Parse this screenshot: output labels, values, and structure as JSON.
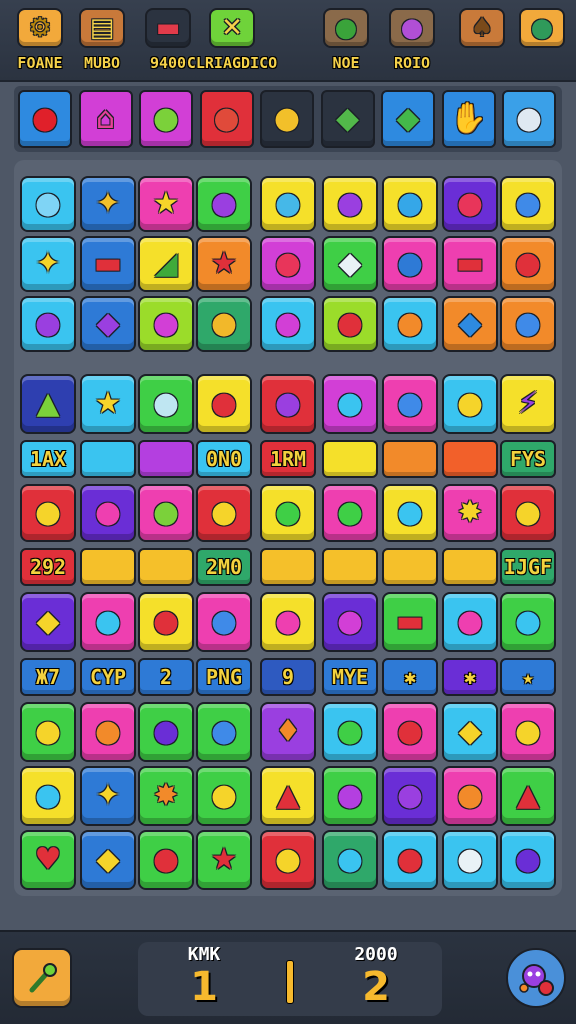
{
  "header": {
    "items": [
      {
        "label": "FOANE",
        "icon": "gear-icon",
        "bg": "#f2a93b",
        "glyph": "⚙",
        "glyph_color": "#b8860b"
      },
      {
        "label": "MUBO",
        "icon": "card-icon",
        "bg": "#c8793a",
        "glyph": "▤",
        "glyph_color": "#f5d24a"
      },
      {
        "label": "9400",
        "icon": "flag-icon",
        "bg": "#2b3340",
        "glyph": "▬",
        "glyph_color": "#e23b4a"
      },
      {
        "label": "CLRIAGDICO",
        "icon": "cross-icon",
        "bg": "#6fd33a",
        "glyph": "✕",
        "glyph_color": "#f5d24a"
      },
      {
        "label": "NOE",
        "icon": "frog-icon",
        "bg": "#8a6a4a",
        "glyph": "●",
        "glyph_color": "#3aa33a"
      },
      {
        "label": "ROIO",
        "icon": "monster-icon",
        "bg": "#8a6a4a",
        "glyph": "●",
        "glyph_color": "#b14fd6"
      },
      {
        "label": "",
        "icon": "bag-icon",
        "bg": "#c97a3a",
        "glyph": "♠",
        "glyph_color": "#7a4a1a"
      },
      {
        "label": "",
        "icon": "alien-icon",
        "bg": "#f2a93b",
        "glyph": "●",
        "glyph_color": "#2f9a5a"
      }
    ]
  },
  "tray": [
    {
      "bg": "#2e8ae0",
      "glyph": "●",
      "color": "#e0202a",
      "icon": "red-ball-icon"
    },
    {
      "bg": "#d23fd6",
      "glyph": "⌂",
      "color": "#e8409a",
      "icon": "pink-house-icon"
    },
    {
      "bg": "#d23fd6",
      "glyph": "●",
      "color": "#7bd13a",
      "icon": "green-face-icon"
    },
    {
      "bg": "#e0303a",
      "glyph": "●",
      "color": "#e04a3a",
      "icon": "fish-icon"
    },
    {
      "bg": "#2b3340",
      "glyph": "●",
      "color": "#f2c02a",
      "icon": "sun-face-icon"
    },
    {
      "bg": "#2b3340",
      "glyph": "◆",
      "color": "#52b84a",
      "icon": "leaf-icon"
    },
    {
      "bg": "#2e8ae0",
      "glyph": "◆",
      "color": "#44b84a",
      "icon": "green-leaf-icon"
    },
    {
      "bg": "#2e8ae0",
      "glyph": "✋",
      "color": "#d98a3a",
      "icon": "glove-icon"
    },
    {
      "bg": "#3aa0e8",
      "glyph": "●",
      "color": "#dfe9f2",
      "icon": "ghost-icon"
    }
  ],
  "grid": {
    "rows": [
      [
        {
          "bg": "#3ac4f0",
          "g": "●",
          "c": "#7fd4f5",
          "i": "fish-icon"
        },
        {
          "bg": "#2e7ad6",
          "g": "✦",
          "c": "#f2c02a",
          "i": "sparkle-icon"
        },
        {
          "bg": "#ee3fb0",
          "g": "★",
          "c": "#f5d42a",
          "i": "star-icon"
        },
        {
          "bg": "#3fcf46",
          "g": "●",
          "c": "#9a3fe0",
          "i": "purple-face-icon"
        },
        {
          "bg": "#f5e02a",
          "g": "●",
          "c": "#45b8e8",
          "i": "blue-drop-icon"
        },
        {
          "bg": "#f5e02a",
          "g": "●",
          "c": "#9a3fe0",
          "i": "purple-ball-icon"
        },
        {
          "bg": "#f5e02a",
          "g": "●",
          "c": "#35a7e8",
          "i": "blue-ball-icon"
        },
        {
          "bg": "#6a2ed6",
          "g": "●",
          "c": "#e8355a",
          "i": "red-blob-icon"
        },
        {
          "bg": "#f5e02a",
          "g": "●",
          "c": "#3f8ae8",
          "i": "blue-face-icon"
        }
      ],
      [
        {
          "bg": "#3ac4f0",
          "g": "✦",
          "c": "#f5d42a",
          "i": "sparkle-icon"
        },
        {
          "bg": "#2e7ad6",
          "g": "▬",
          "c": "#e0303a",
          "i": "red-bar-icon"
        },
        {
          "bg": "#f5e02a",
          "g": "◢",
          "c": "#3faa3a",
          "i": "pencil-icon"
        },
        {
          "bg": "#f28a2a",
          "g": "★",
          "c": "#e0303a",
          "i": "red-star-icon"
        },
        {
          "bg": "#d23fd6",
          "g": "●",
          "c": "#e8355a",
          "i": "apple-icon"
        },
        {
          "bg": "#3fcf46",
          "g": "◆",
          "c": "#e9f2f6",
          "i": "diamond-icon"
        },
        {
          "bg": "#ee3fb0",
          "g": "●",
          "c": "#2e7ad6",
          "i": "blue-orb-icon"
        },
        {
          "bg": "#ee3fb0",
          "g": "▬",
          "c": "#e0303a",
          "i": "chili-icon"
        },
        {
          "bg": "#f28a2a",
          "g": "●",
          "c": "#e0303a",
          "i": "tomato-icon"
        }
      ],
      [
        {
          "bg": "#3ac4f0",
          "g": "●",
          "c": "#9a3fe0",
          "i": "purple-face-icon"
        },
        {
          "bg": "#2e7ad6",
          "g": "◆",
          "c": "#9a3fe0",
          "i": "purple-gem-icon"
        },
        {
          "bg": "#9bdc2a",
          "g": "●",
          "c": "#d23fd6",
          "i": "pink-face-icon"
        },
        {
          "bg": "#2fa86a",
          "g": "●",
          "c": "#f2b82a",
          "i": "orange-ball-icon"
        },
        {
          "bg": "#3ac4f0",
          "g": "●",
          "c": "#d23fd6",
          "i": "pink-drop-icon"
        },
        {
          "bg": "#9bdc2a",
          "g": "●",
          "c": "#e0303a",
          "i": "red-face-icon"
        },
        {
          "bg": "#3ac4f0",
          "g": "●",
          "c": "#f28a2a",
          "i": "orange-fruit-icon"
        },
        {
          "bg": "#f28a2a",
          "g": "◆",
          "c": "#2e8ae0",
          "i": "blue-gem-icon"
        },
        {
          "bg": "#f28a2a",
          "g": "●",
          "c": "#3f8ae8",
          "i": "blue-face-icon"
        }
      ],
      [
        {
          "bg": "#2e3fb0",
          "g": "▲",
          "c": "#7bd13a",
          "i": "potion-icon"
        },
        {
          "bg": "#3ac4f0",
          "g": "★",
          "c": "#f5d42a",
          "i": "star-icon"
        },
        {
          "bg": "#3fcf46",
          "g": "●",
          "c": "#bfe6f2",
          "i": "white-orb-icon"
        },
        {
          "bg": "#f5e02a",
          "g": "●",
          "c": "#e0303a",
          "i": "apple-icon"
        },
        {
          "bg": "#e0303a",
          "g": "●",
          "c": "#9a3fe0",
          "i": "purple-ball-icon"
        },
        {
          "bg": "#d23fd6",
          "g": "●",
          "c": "#3ac4f0",
          "i": "blue-face-icon"
        },
        {
          "bg": "#ee3fb0",
          "g": "●",
          "c": "#3f8ae8",
          "i": "blue-bird-icon"
        },
        {
          "bg": "#3ac4f0",
          "g": "●",
          "c": "#f5d42a",
          "i": "yellow-face-icon"
        },
        {
          "bg": "#f5e02a",
          "g": "⚡",
          "c": "#9a3fe0",
          "i": "lightning-icon"
        }
      ]
    ],
    "bar_row1": [
      {
        "text": "1AX",
        "bg": "#3ac4f0",
        "span": 1
      },
      {
        "text": "",
        "bg": "#3ac4f0",
        "span": 1
      },
      {
        "text": "",
        "bg": "#b43fe0",
        "span": 1
      },
      {
        "text": "0N0",
        "bg": "#3ac4f0",
        "span": 1
      },
      {
        "text": "1RM",
        "bg": "#e0303a",
        "span": 1
      },
      {
        "text": "",
        "bg": "#f5e02a",
        "span": 1
      },
      {
        "text": "",
        "bg": "#f28a2a",
        "span": 1
      },
      {
        "text": "",
        "bg": "#f2602a",
        "span": 1
      },
      {
        "text": "FYS",
        "bg": "#2fa86a",
        "span": 1
      }
    ],
    "mid_row": [
      {
        "bg": "#e0303a",
        "g": "●",
        "c": "#f5d42a",
        "i": "sun-face-icon"
      },
      {
        "bg": "#6a2ed6",
        "g": "●",
        "c": "#ee3fb0",
        "i": "balloon-icon"
      },
      {
        "bg": "#ee3fb0",
        "g": "●",
        "c": "#7bd13a",
        "i": "green-face-icon"
      },
      {
        "bg": "#e0303a",
        "g": "●",
        "c": "#f5d42a",
        "i": "sun-face-icon"
      },
      {
        "bg": "#f5e02a",
        "g": "●",
        "c": "#3fcf46",
        "i": "frog-icon"
      },
      {
        "bg": "#ee3fb0",
        "g": "●",
        "c": "#3fcf46",
        "i": "green-face-icon"
      },
      {
        "bg": "#f5e02a",
        "g": "●",
        "c": "#3ac4f0",
        "i": "blue-drop-icon"
      },
      {
        "bg": "#ee3fb0",
        "g": "✸",
        "c": "#f5d42a",
        "i": "burst-icon"
      },
      {
        "bg": "#e0303a",
        "g": "●",
        "c": "#f5d42a",
        "i": "sun-face-icon"
      }
    ],
    "bar_row2": [
      {
        "text": "292",
        "bg": "#e0303a",
        "span": 1
      },
      {
        "text": "",
        "bg": "#f5c02a",
        "span": 1
      },
      {
        "text": "",
        "bg": "#f5c02a",
        "span": 1
      },
      {
        "text": "2M0",
        "bg": "#2fa86a",
        "span": 1
      },
      {
        "text": "",
        "bg": "#f5c02a",
        "span": 1
      },
      {
        "text": "",
        "bg": "#f5c02a",
        "span": 1
      },
      {
        "text": "",
        "bg": "#f5c02a",
        "span": 1
      },
      {
        "text": "",
        "bg": "#f5c02a",
        "span": 1
      },
      {
        "text": "IJGF",
        "bg": "#2fa86a",
        "span": 1
      }
    ],
    "row5": [
      {
        "bg": "#6a2ed6",
        "g": "◆",
        "c": "#f5d42a",
        "i": "ticket-icon"
      },
      {
        "bg": "#ee3fb0",
        "g": "●",
        "c": "#3ac4f0",
        "i": "balloon-icon"
      },
      {
        "bg": "#f5e02a",
        "g": "●",
        "c": "#e0303a",
        "i": "tomato-icon"
      },
      {
        "bg": "#ee3fb0",
        "g": "●",
        "c": "#3f8ae8",
        "i": "blue-face-icon"
      },
      {
        "bg": "#f5e02a",
        "g": "●",
        "c": "#ee3fb0",
        "i": "spider-icon"
      },
      {
        "bg": "#6a2ed6",
        "g": "●",
        "c": "#d23fd6",
        "i": "pink-ball-icon"
      },
      {
        "bg": "#3fcf46",
        "g": "▬",
        "c": "#e0303a",
        "i": "flag-icon"
      },
      {
        "bg": "#3ac4f0",
        "g": "●",
        "c": "#ee3fb0",
        "i": "balloon-icon"
      },
      {
        "bg": "#3fcf46",
        "g": "●",
        "c": "#3ac4f0",
        "i": "blue-face-icon"
      }
    ],
    "bar_row3": [
      {
        "text": "Ж7",
        "bg": "#2e7ad6"
      },
      {
        "text": "CYP",
        "bg": "#2e7ad6"
      },
      {
        "text": "2",
        "bg": "#2e7ad6"
      },
      {
        "text": "PNG",
        "bg": "#2e7ad6"
      },
      {
        "text": "9",
        "bg": "#2e5ac0"
      },
      {
        "text": "MYE",
        "bg": "#2e7ad6"
      },
      {
        "text": "✱",
        "bg": "#2e7ad6"
      },
      {
        "text": "✱",
        "bg": "#6a2ed6"
      },
      {
        "text": "★",
        "bg": "#2e7ad6"
      }
    ],
    "rows_bottom": [
      [
        {
          "bg": "#3fcf46",
          "g": "●",
          "c": "#f5d42a",
          "i": "sun-face-icon"
        },
        {
          "bg": "#ee3fb0",
          "g": "●",
          "c": "#f28a2a",
          "i": "orange-fruit-icon"
        },
        {
          "bg": "#3fcf46",
          "g": "●",
          "c": "#6a2ed6",
          "i": "purple-ball-icon"
        },
        {
          "bg": "#3fcf46",
          "g": "●",
          "c": "#3f8ae8",
          "i": "blue-bird-icon"
        },
        {
          "bg": "#9a3fe0",
          "g": "♦",
          "c": "#f28a2a",
          "i": "orange-drop-icon"
        },
        {
          "bg": "#3ac4f0",
          "g": "●",
          "c": "#3fcf46",
          "i": "green-ball-icon"
        },
        {
          "bg": "#ee3fb0",
          "g": "●",
          "c": "#e0303a",
          "i": "red-face-icon"
        },
        {
          "bg": "#3ac4f0",
          "g": "◆",
          "c": "#f5d42a",
          "i": "corn-icon"
        },
        {
          "bg": "#ee3fb0",
          "g": "●",
          "c": "#f5d42a",
          "i": "yellow-face-icon"
        }
      ],
      [
        {
          "bg": "#f5e02a",
          "g": "●",
          "c": "#3ac4f0",
          "i": "blue-bird-icon"
        },
        {
          "bg": "#2e7ad6",
          "g": "✦",
          "c": "#f5d42a",
          "i": "sparkle-icon"
        },
        {
          "bg": "#3fcf46",
          "g": "✸",
          "c": "#f28a2a",
          "i": "burst-icon"
        },
        {
          "bg": "#3fcf46",
          "g": "●",
          "c": "#f5d42a",
          "i": "fruit-icon"
        },
        {
          "bg": "#f5e02a",
          "g": "▲",
          "c": "#e0303a",
          "i": "cake-icon"
        },
        {
          "bg": "#3fcf46",
          "g": "●",
          "c": "#b43fe0",
          "i": "purple-ball-icon"
        },
        {
          "bg": "#6a2ed6",
          "g": "●",
          "c": "#9a3fe0",
          "i": "purple-ball-icon"
        },
        {
          "bg": "#ee3fb0",
          "g": "●",
          "c": "#f28a2a",
          "i": "orange-fish-icon"
        },
        {
          "bg": "#3fcf46",
          "g": "▲",
          "c": "#e0303a",
          "i": "chili-icon"
        }
      ],
      [
        {
          "bg": "#3fcf46",
          "g": "♥",
          "c": "#e0303a",
          "i": "apple-icon"
        },
        {
          "bg": "#2e7ad6",
          "g": "◆",
          "c": "#f5d42a",
          "i": "corn-icon"
        },
        {
          "bg": "#3fcf46",
          "g": "●",
          "c": "#e0303a",
          "i": "apple-icon"
        },
        {
          "bg": "#3fcf46",
          "g": "★",
          "c": "#e0303a",
          "i": "red-star-icon"
        },
        {
          "bg": "#e0303a",
          "g": "●",
          "c": "#f5d42a",
          "i": "yellow-face-icon"
        },
        {
          "bg": "#2fa86a",
          "g": "●",
          "c": "#3ac4f0",
          "i": "blue-bird-icon"
        },
        {
          "bg": "#3ac4f0",
          "g": "●",
          "c": "#e0303a",
          "i": "red-ball-icon"
        },
        {
          "bg": "#3ac4f0",
          "g": "●",
          "c": "#e9f2f6",
          "i": "white-drop-icon"
        },
        {
          "bg": "#3ac4f0",
          "g": "●",
          "c": "#6a2ed6",
          "i": "purple-ball-icon"
        }
      ]
    ]
  },
  "footer": {
    "left_button_icon": "wand-icon",
    "player1": {
      "label": "KMK",
      "value": "1"
    },
    "player2": {
      "label": "2000",
      "value": "2"
    },
    "right_button_icon": "character-icon"
  }
}
